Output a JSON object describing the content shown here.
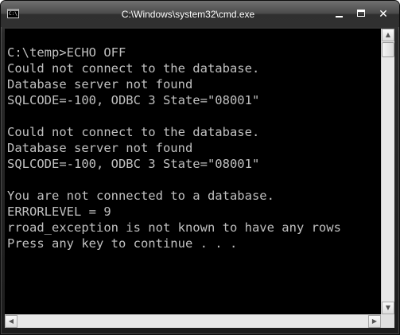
{
  "window": {
    "title": "C:\\Windows\\system32\\cmd.exe",
    "icon_text": "C:\\"
  },
  "controls": {
    "close_glyph": "✕"
  },
  "console": {
    "lines": [
      "C:\\temp>ECHO OFF",
      "Could not connect to the database.",
      "Database server not found",
      "SQLCODE=-100, ODBC 3 State=\"08001\"",
      "",
      "Could not connect to the database.",
      "Database server not found",
      "SQLCODE=-100, ODBC 3 State=\"08001\"",
      "",
      "You are not connected to a database.",
      "ERRORLEVEL = 9",
      "rroad_exception is not known to have any rows",
      "Press any key to continue . . ."
    ]
  },
  "scrollbars": {
    "up_arrow": "▲",
    "down_arrow": "▼",
    "left_arrow": "◀",
    "right_arrow": "▶"
  },
  "colors": {
    "console_bg": "#000000",
    "console_fg": "#c0c0c0",
    "frame": "#2b2b2b"
  }
}
